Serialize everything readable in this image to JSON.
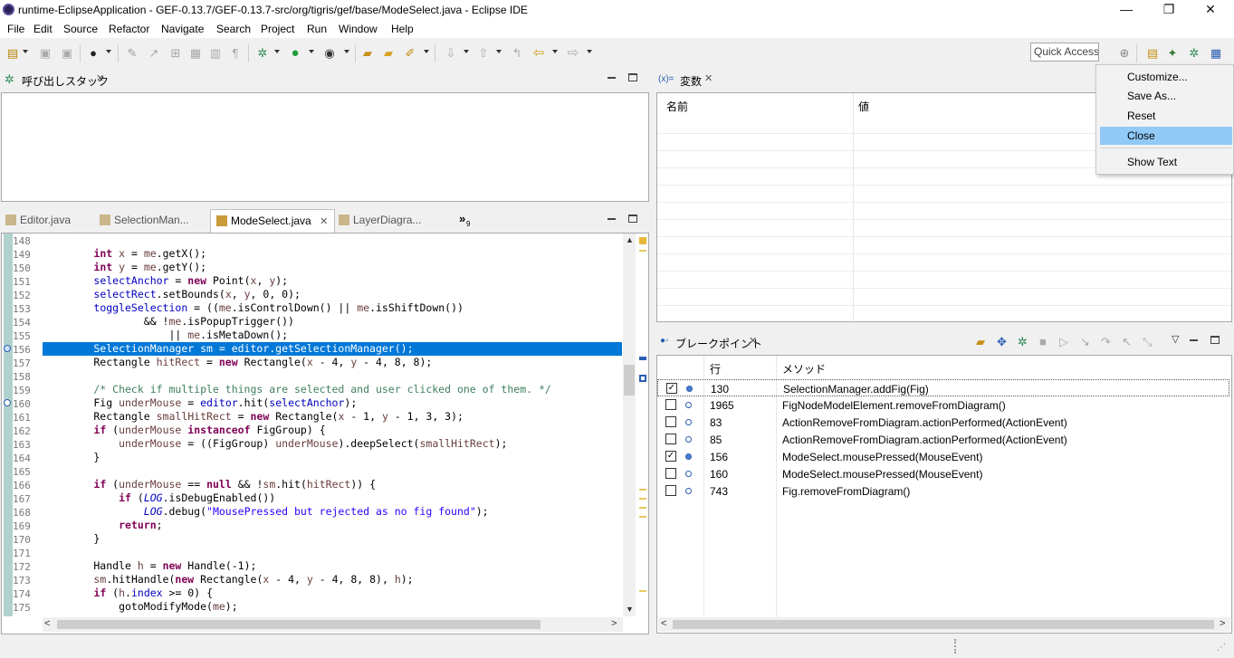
{
  "window": {
    "title": "runtime-EclipseApplication - GEF-0.13.7/GEF-0.13.7-src/org/tigris/gef/base/ModeSelect.java - Eclipse IDE",
    "minimize": "—",
    "maximize": "❐",
    "close": "✕"
  },
  "menu": [
    "File",
    "Edit",
    "Source",
    "Refactor",
    "Navigate",
    "Search",
    "Project",
    "Run",
    "Window",
    "Help"
  ],
  "quick_access": "Quick Access",
  "call_stack_view": {
    "title": "呼び出しスタック"
  },
  "variables_view": {
    "title": "変数",
    "prefix": "(x)=",
    "col_name": "名前",
    "col_value": "値"
  },
  "editor": {
    "tabs": [
      "Editor.java",
      "SelectionMan...",
      "ModeSelect.java",
      "LayerDiagra..."
    ],
    "overflow": "»",
    "overflow_count": "9"
  },
  "code_lines": [
    {
      "n": "148",
      "t": ""
    },
    {
      "n": "149",
      "t": "        int x = me.getX();"
    },
    {
      "n": "150",
      "t": "        int y = me.getY();"
    },
    {
      "n": "151",
      "t": "        selectAnchor = new Point(x, y);"
    },
    {
      "n": "152",
      "t": "        selectRect.setBounds(x, y, 0, 0);"
    },
    {
      "n": "153",
      "t": "        toggleSelection = ((me.isControlDown() || me.isShiftDown())"
    },
    {
      "n": "154",
      "t": "                && !me.isPopupTrigger())"
    },
    {
      "n": "155",
      "t": "                    || me.isMetaDown();"
    },
    {
      "n": "156",
      "t": "        SelectionManager sm = editor.getSelectionManager();"
    },
    {
      "n": "157",
      "t": "        Rectangle hitRect = new Rectangle(x - 4, y - 4, 8, 8);"
    },
    {
      "n": "158",
      "t": ""
    },
    {
      "n": "159",
      "t": "        /* Check if multiple things are selected and user clicked one of them. */"
    },
    {
      "n": "160",
      "t": "        Fig underMouse = editor.hit(selectAnchor);"
    },
    {
      "n": "161",
      "t": "        Rectangle smallHitRect = new Rectangle(x - 1, y - 1, 3, 3);"
    },
    {
      "n": "162",
      "t": "        if (underMouse instanceof FigGroup) {"
    },
    {
      "n": "163",
      "t": "            underMouse = ((FigGroup) underMouse).deepSelect(smallHitRect);"
    },
    {
      "n": "164",
      "t": "        }"
    },
    {
      "n": "165",
      "t": ""
    },
    {
      "n": "166",
      "t": "        if (underMouse == null && !sm.hit(hitRect)) {"
    },
    {
      "n": "167",
      "t": "            if (LOG.isDebugEnabled())"
    },
    {
      "n": "168",
      "t": "                LOG.debug(\"MousePressed but rejected as no fig found\");"
    },
    {
      "n": "169",
      "t": "            return;"
    },
    {
      "n": "170",
      "t": "        }"
    },
    {
      "n": "171",
      "t": ""
    },
    {
      "n": "172",
      "t": "        Handle h = new Handle(-1);"
    },
    {
      "n": "173",
      "t": "        sm.hitHandle(new Rectangle(x - 4, y - 4, 8, 8), h);"
    },
    {
      "n": "174",
      "t": "        if (h.index >= 0) {"
    },
    {
      "n": "175",
      "t": "            gotoModifyMode(me);"
    }
  ],
  "breakpoints_view": {
    "title": "ブレークポイント",
    "col_line": "行",
    "col_method": "メソッド",
    "rows": [
      {
        "checked": true,
        "line": "130",
        "method": "SelectionManager.addFig(Fig)"
      },
      {
        "checked": false,
        "line": "1965",
        "method": "FigNodeModelElement.removeFromDiagram()"
      },
      {
        "checked": false,
        "line": "83",
        "method": "ActionRemoveFromDiagram.actionPerformed(ActionEvent)"
      },
      {
        "checked": false,
        "line": "85",
        "method": "ActionRemoveFromDiagram.actionPerformed(ActionEvent)"
      },
      {
        "checked": true,
        "line": "156",
        "method": "ModeSelect.mousePressed(MouseEvent)"
      },
      {
        "checked": false,
        "line": "160",
        "method": "ModeSelect.mousePressed(MouseEvent)"
      },
      {
        "checked": false,
        "line": "743",
        "method": "Fig.removeFromDiagram()"
      }
    ]
  },
  "context_menu": {
    "items": [
      "Customize...",
      "Save As...",
      "Reset",
      "Close",
      "Show Text"
    ],
    "selected": "Close"
  },
  "colors": {
    "selection": "#0078d7",
    "menu_highlight": "#91c9f7",
    "keyword": "#7f0055",
    "field": "#0000c0",
    "comment": "#3f7f5f",
    "string": "#2a00ff"
  }
}
